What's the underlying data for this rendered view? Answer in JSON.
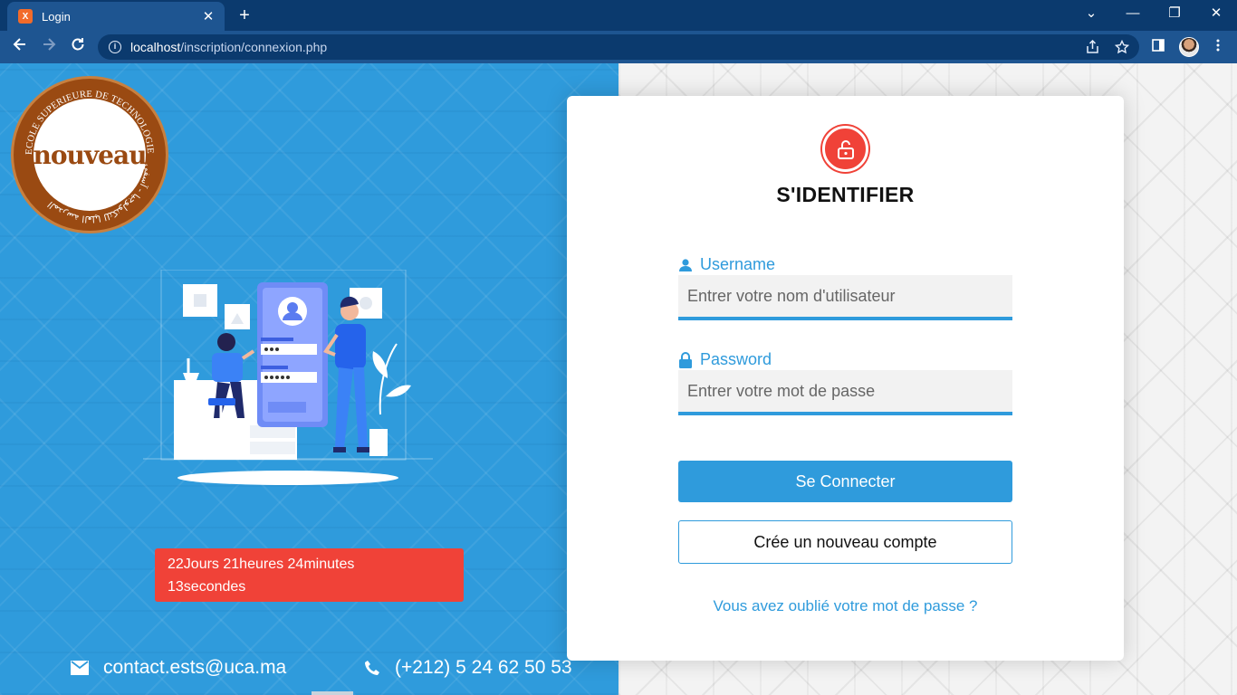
{
  "browser": {
    "tab_title": "Login",
    "tab_favicon": "X",
    "close_tab": "✕",
    "new_tab": "+",
    "url_host": "localhost",
    "url_path": "/inscription/connexion.php",
    "window_controls": [
      "⌄",
      "—",
      "❐",
      "✕"
    ]
  },
  "logo": {
    "word": "nouveau",
    "ring_text": "ECOLE SUPERIEURE DE TECHNOLOGIE -SAFI",
    "ring_text_ar": "المدرسة العليا للتكنولوجيا - آسفي"
  },
  "countdown": {
    "line1": "22Jours 21heures 24minutes",
    "line2": "13secondes"
  },
  "contact": {
    "email": "contact.ests@uca.ma",
    "phone": "(+212) 5 24 62 50 53",
    "email_icon": "mail-icon",
    "phone_icon": "phone-icon"
  },
  "login": {
    "title": "S'IDENTIFIER",
    "username_label": "Username",
    "username_placeholder": "Entrer votre nom d'utilisateur",
    "password_label": "Password",
    "password_placeholder": "Entrer votre mot de passe",
    "submit": "Se Connecter",
    "register": "Crée un nouveau compte",
    "forgot": "Vous avez oublié votre mot de passe ?"
  },
  "colors": {
    "primary": "#2f9bdc",
    "danger": "#f04238",
    "logo_brown": "#9a4a12"
  }
}
